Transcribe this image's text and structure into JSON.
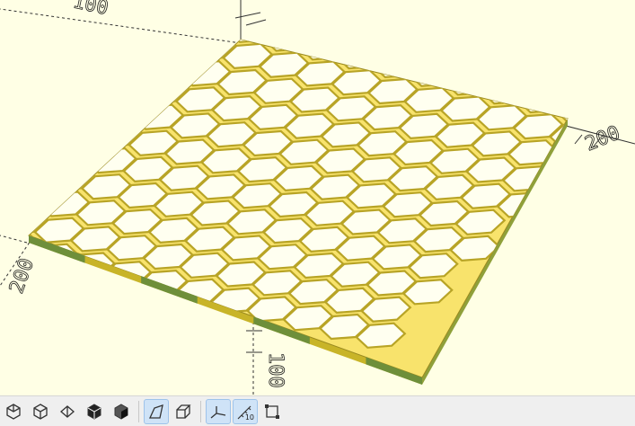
{
  "app": "OpenSCAD",
  "viewport": {
    "background": "#ffffe5",
    "model_face_color": "#f8e36c",
    "model_side_color": "#c8b428",
    "model_alt_side_color": "#6e8f3a",
    "axis_numbers": [
      {
        "text": "100"
      },
      {
        "text": "200"
      },
      {
        "text": "100"
      },
      {
        "text": "200"
      },
      {
        "text": "10"
      }
    ]
  },
  "toolbar": {
    "buttons": [
      {
        "icon": "view-diagonal-icon"
      },
      {
        "icon": "view-top-icon"
      },
      {
        "icon": "view-bottom-icon"
      },
      {
        "icon": "view-left-icon"
      },
      {
        "icon": "view-right-icon"
      },
      {
        "icon": "perspective-icon",
        "active": true
      },
      {
        "icon": "orthogonal-icon"
      },
      {
        "icon": "show-axes-icon",
        "active": true
      },
      {
        "icon": "show-scale-markers-icon",
        "active": true,
        "label": "10"
      },
      {
        "icon": "show-edges-icon"
      }
    ]
  }
}
